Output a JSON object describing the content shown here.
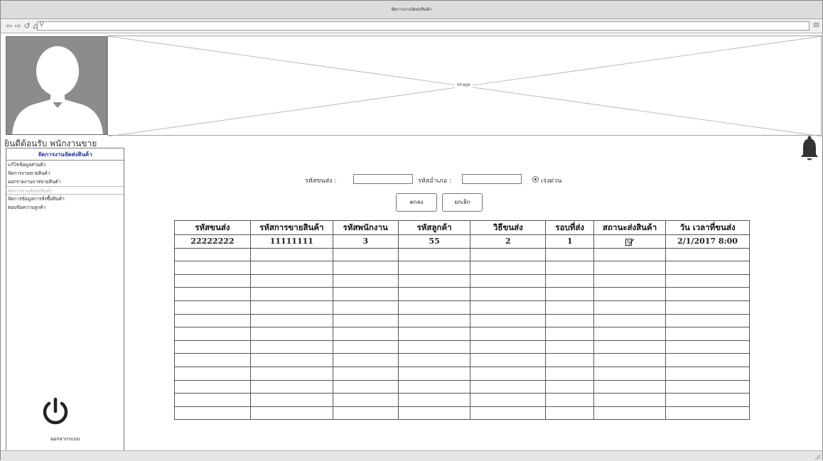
{
  "window": {
    "title": "จัดการงานจัดส่งสินค้า"
  },
  "browser": {
    "url": ""
  },
  "banner": {
    "label": "Image"
  },
  "header": {
    "welcome_text": "ยินดีต้อนรับ พนักงานขาย"
  },
  "sidebar": {
    "title": "จัดการงานจัดส่งสินค้า",
    "items": [
      {
        "label": "แก้ไขข้อมูลส่วนตัว"
      },
      {
        "label": "จัดการงานขายสินค้า"
      },
      {
        "label": "ออกรายงานการขายสินค้า"
      },
      {
        "label": "จัดการงานจัดส่งสินค้า"
      },
      {
        "label": "จัดการข้อมูลการสั่งซื้อสินค้า"
      },
      {
        "label": "ตอบข้อความลูกค้า"
      }
    ],
    "logout_label": "ออกจากระบบ"
  },
  "form": {
    "shipping_code_label": "รหัสขนส่ง :",
    "shipping_code_value": "",
    "district_code_label": "รหัสอำเภอ :",
    "district_code_value": "",
    "urgent_label": "เร่งด่วน",
    "urgent_checked": true,
    "ok_label": "ตกลง",
    "cancel_label": "ยกเลิก"
  },
  "table": {
    "headers": [
      "รหัสขนส่ง",
      "รหัสการขายสินค้า",
      "รหัสพนักงาน",
      "รหัสลูกค้า",
      "วิธีขนส่ง",
      "รอบที่ส่ง",
      "สถานะส่งสินค้า",
      "วัน เวลาที่ขนส่ง"
    ],
    "rows": [
      [
        "22222222",
        "11111111",
        "3",
        "55",
        "2",
        "1",
        "",
        "2/1/2017 8:00"
      ],
      [
        "",
        "",
        "",
        "",
        "",
        "",
        "",
        ""
      ],
      [
        "",
        "",
        "",
        "",
        "",
        "",
        "",
        ""
      ],
      [
        "",
        "",
        "",
        "",
        "",
        "",
        "",
        ""
      ],
      [
        "",
        "",
        "",
        "",
        "",
        "",
        "",
        ""
      ],
      [
        "",
        "",
        "",
        "",
        "",
        "",
        "",
        ""
      ],
      [
        "",
        "",
        "",
        "",
        "",
        "",
        "",
        ""
      ],
      [
        "",
        "",
        "",
        "",
        "",
        "",
        "",
        ""
      ],
      [
        "",
        "",
        "",
        "",
        "",
        "",
        "",
        ""
      ],
      [
        "",
        "",
        "",
        "",
        "",
        "",
        "",
        ""
      ],
      [
        "",
        "",
        "",
        "",
        "",
        "",
        "",
        ""
      ],
      [
        "",
        "",
        "",
        "",
        "",
        "",
        "",
        ""
      ],
      [
        "",
        "",
        "",
        "",
        "",
        "",
        "",
        ""
      ],
      [
        "",
        "",
        "",
        "",
        "",
        "",
        "",
        ""
      ]
    ],
    "status_icon": "edit-icon"
  },
  "icons": {
    "nav": [
      "back-icon",
      "forward-icon",
      "refresh-icon",
      "home-icon",
      "search-icon",
      "menu-icon"
    ],
    "notification": "bell-icon",
    "logout": "power-icon"
  }
}
